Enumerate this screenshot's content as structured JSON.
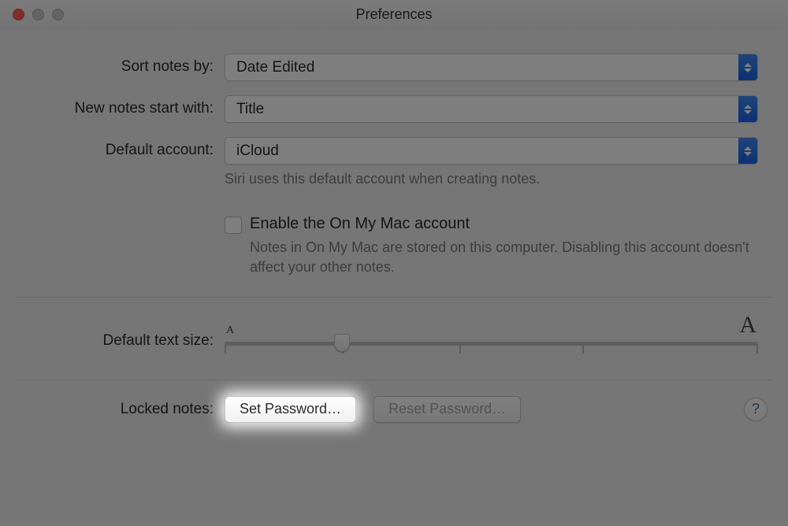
{
  "window": {
    "title": "Preferences"
  },
  "rows": {
    "sort": {
      "label": "Sort notes by:",
      "value": "Date Edited"
    },
    "start": {
      "label": "New notes start with:",
      "value": "Title"
    },
    "account": {
      "label": "Default account:",
      "value": "iCloud",
      "hint": "Siri uses this default account when creating notes."
    },
    "onmymac": {
      "label": "Enable the On My Mac account",
      "hint": "Notes in On My Mac are stored on this computer. Disabling this account doesn't affect your other notes."
    },
    "textsize": {
      "label": "Default text size:",
      "min_glyph": "A",
      "max_glyph": "A"
    },
    "locked": {
      "label": "Locked notes:",
      "set_btn": "Set Password…",
      "reset_btn": "Reset Password…",
      "help": "?"
    }
  }
}
